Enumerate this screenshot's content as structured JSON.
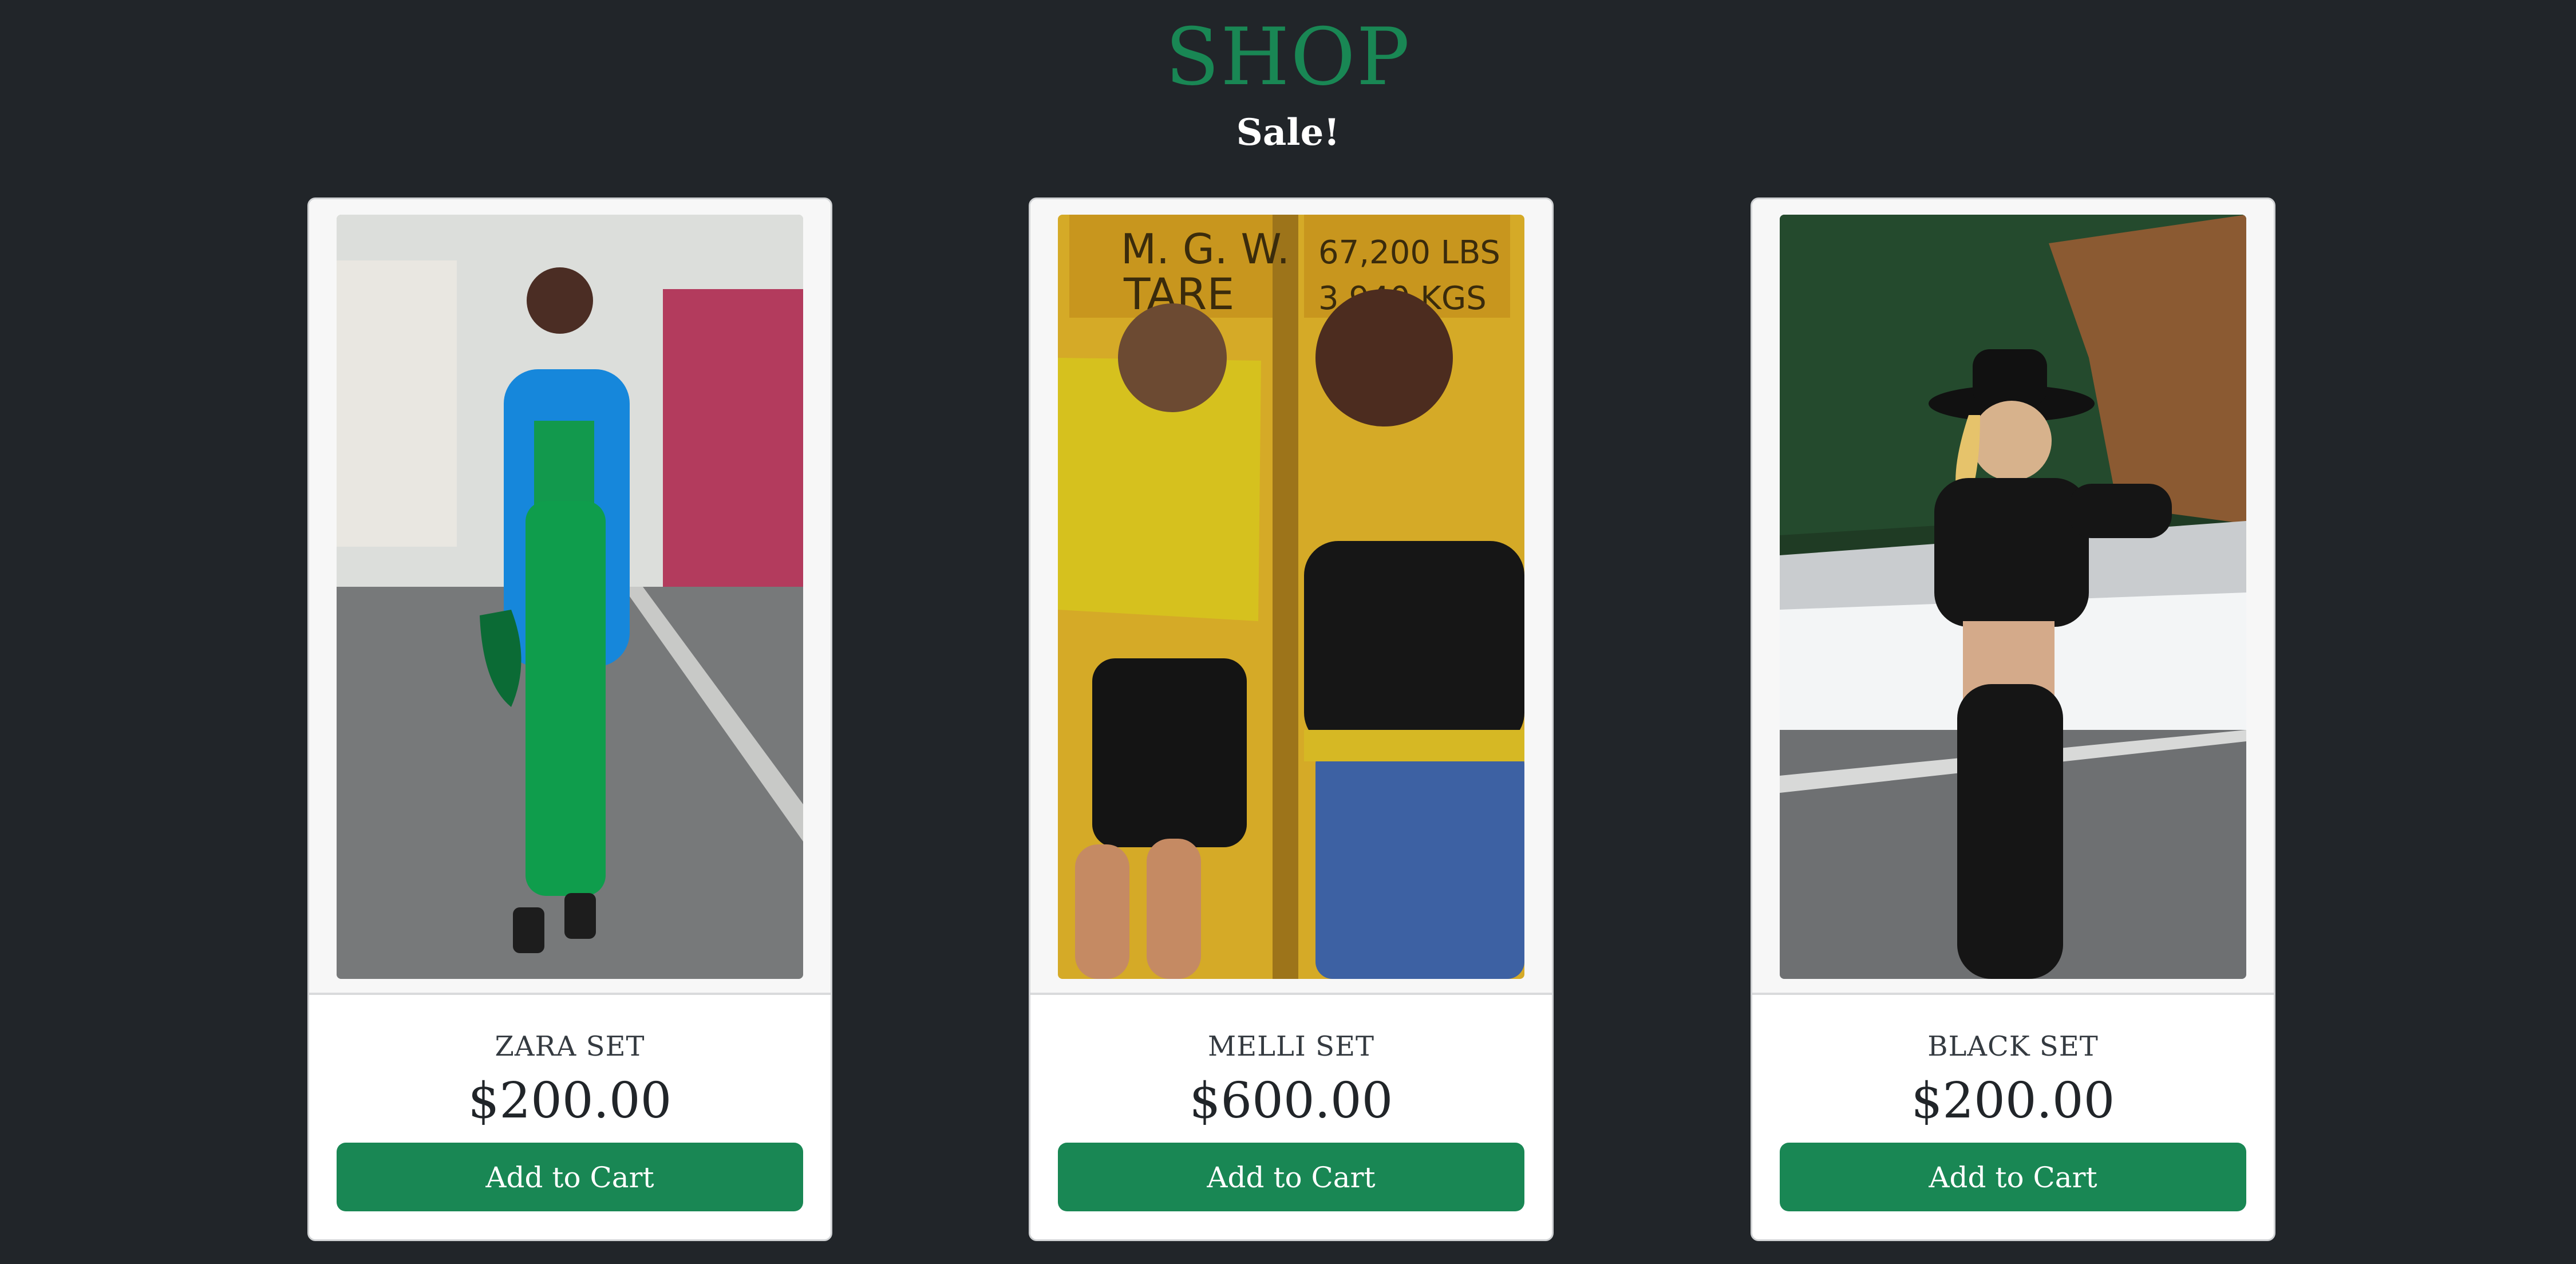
{
  "header": {
    "title": "SHOP",
    "subtitle": "Sale!"
  },
  "products": [
    {
      "name": "ZARA SET",
      "price": "$200.00",
      "button": "Add to Cart",
      "image": "woman-green-outfit-blue-coat-street"
    },
    {
      "name": "MELLI SET",
      "price": "$600.00",
      "button": "Add to Cart",
      "image": "two-women-yellow-sweater-black-crop-top"
    },
    {
      "name": "BLACK SET",
      "price": "$200.00",
      "button": "Add to Cart",
      "image": "woman-black-hat-black-outfit-snow"
    }
  ],
  "colors": {
    "background": "#212529",
    "accent": "#198754",
    "card": "#ffffff"
  }
}
